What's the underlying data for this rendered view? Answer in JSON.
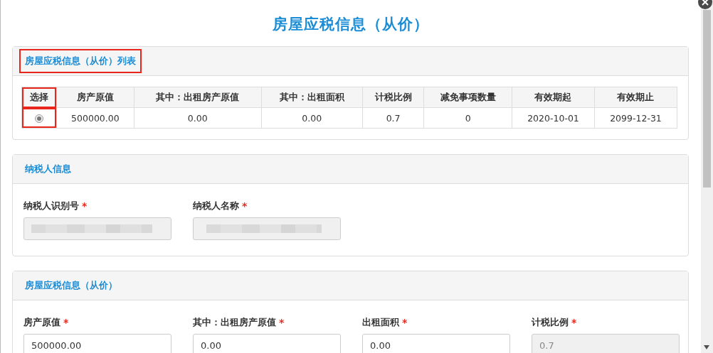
{
  "dialog": {
    "title": "房屋应税信息（从价）"
  },
  "list_panel": {
    "title": "房屋应税信息（从价）列表",
    "title_highlighted": true,
    "table": {
      "columns": [
        {
          "label": "选择",
          "highlighted": true
        },
        {
          "label": "房产原值",
          "highlighted": false
        },
        {
          "label": "其中：出租房产原值",
          "highlighted": false
        },
        {
          "label": "其中：出租面积",
          "highlighted": false
        },
        {
          "label": "计税比例",
          "highlighted": false
        },
        {
          "label": "减免事项数量",
          "highlighted": false
        },
        {
          "label": "有效期起",
          "highlighted": false
        },
        {
          "label": "有效期止",
          "highlighted": false
        }
      ],
      "rows": [
        {
          "cells": [
            {
              "kind": "radio",
              "selected": true
            },
            {
              "kind": "text",
              "text": "500000.00"
            },
            {
              "kind": "text",
              "text": "0.00"
            },
            {
              "kind": "text",
              "text": "0.00"
            },
            {
              "kind": "text",
              "text": "0.7"
            },
            {
              "kind": "text",
              "text": "0"
            },
            {
              "kind": "text",
              "text": "2020-10-01"
            },
            {
              "kind": "text",
              "text": "2099-12-31"
            }
          ]
        }
      ]
    }
  },
  "taxpayer_panel": {
    "title": "纳税人信息",
    "fields": [
      {
        "label": "纳税人识别号",
        "required_mark": "*",
        "kind": "blurred",
        "disabled": true
      },
      {
        "label": "纳税人名称",
        "required_mark": "*",
        "kind": "blurred",
        "disabled": true
      }
    ]
  },
  "house_panel": {
    "title": "房屋应税信息（从价）",
    "fields": [
      {
        "label": "房产原值",
        "required_mark": "*",
        "kind": "text",
        "value": "500000.00",
        "disabled": false
      },
      {
        "label": "其中：出租房产原值",
        "required_mark": "*",
        "kind": "text",
        "value": "0.00",
        "disabled": false
      },
      {
        "label": "出租面积",
        "required_mark": "*",
        "kind": "text",
        "value": "0.00",
        "disabled": false
      },
      {
        "label": "计税比例",
        "required_mark": "*",
        "kind": "text",
        "value": "0.7",
        "disabled": true
      }
    ]
  }
}
